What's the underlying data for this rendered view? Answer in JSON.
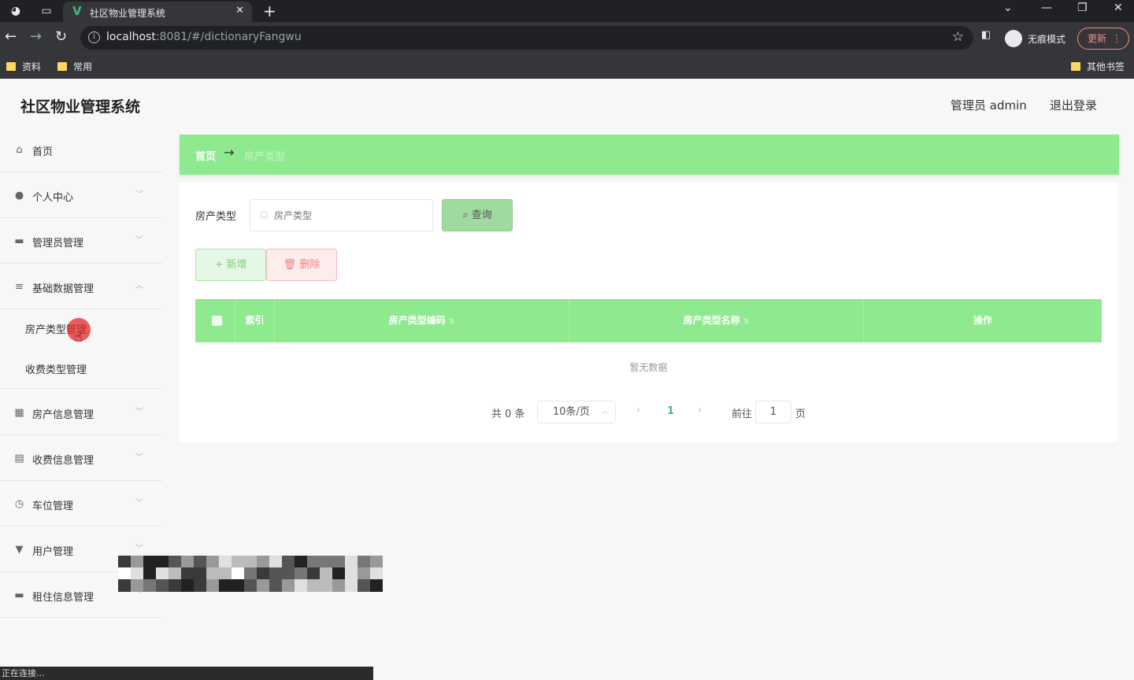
{
  "browser": {
    "tab_title": "社区物业管理系统",
    "url_host": "localhost",
    "url_rest": ":8081/#/dictionaryFangwu",
    "incognito_label": "无痕模式",
    "update_label": "更新",
    "bookmarks": [
      "资料",
      "常用"
    ],
    "other_bookmarks": "其他书签"
  },
  "header": {
    "app_title": "社区物业管理系统",
    "user_label": "管理员 admin",
    "logout_label": "退出登录"
  },
  "sidebar": {
    "items": [
      {
        "label": "首页"
      },
      {
        "label": "个人中心"
      },
      {
        "label": "管理员管理"
      },
      {
        "label": "基础数据管理"
      },
      {
        "label": "房产信息管理"
      },
      {
        "label": "收费信息管理"
      },
      {
        "label": "车位管理"
      },
      {
        "label": "用户管理"
      },
      {
        "label": "租住信息管理"
      }
    ],
    "sub_items": [
      {
        "label": "房产类型管理"
      },
      {
        "label": "收费类型管理"
      }
    ]
  },
  "breadcrumb": {
    "home": "首页",
    "separator": "→",
    "current": "房产类型"
  },
  "search": {
    "label": "房产类型",
    "placeholder": "房产类型",
    "query_label": "查询"
  },
  "actions": {
    "add_label": "新增",
    "delete_label": "删除"
  },
  "table": {
    "columns": [
      "索引",
      "房产类型编码",
      "房产类型名称",
      "操作"
    ],
    "empty_text": "暂无数据"
  },
  "pagination": {
    "total": "共 0 条",
    "page_size": "10条/页",
    "current_page": "1",
    "goto_label": "前往",
    "jump_value": "1",
    "page_suffix": "页"
  },
  "status_text": "正在连接..."
}
